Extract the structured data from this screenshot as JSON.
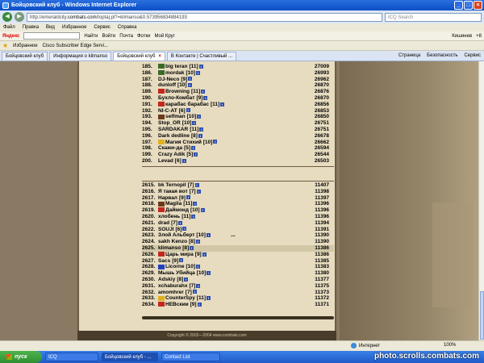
{
  "window": {
    "title": "Бойцовский клуб - Windows Internet Explorer"
  },
  "address": {
    "url_prefix": "http://emeraldcity.",
    "url_domain": "combats.com",
    "url_suffix": "/toptaj.pl?=klimanso&0.573956834884193",
    "search_placeholder": "ICQ Search"
  },
  "menu": [
    "Файл",
    "Правка",
    "Вид",
    "Избранное",
    "Сервис",
    "Справка"
  ],
  "yandex": {
    "logo": "Яндекс",
    "find": "Найти",
    "login": "Войти",
    "mail": "Почта",
    "photos": "Фотки",
    "mycircle": "Мой Круг",
    "city": "Кишинев",
    "temp": "+8"
  },
  "favorites": {
    "label": "Избранное",
    "link": "Cisco Subscriber Edge Servi..."
  },
  "tabs": [
    {
      "label": "Бойцовский клуб",
      "active": false
    },
    {
      "label": "Информация о klimanso",
      "active": false
    },
    {
      "label": "Бойцовский клуб",
      "active": true
    },
    {
      "label": "В Контакте | Счастливый ...",
      "active": false
    }
  ],
  "tab_commands": {
    "page": "Страница",
    "safety": "Безопасность",
    "service": "Сервис"
  },
  "top_rows": [
    {
      "n": "185.",
      "name": "big teran",
      "lvl": "[11]",
      "score": "27009",
      "icon": "g"
    },
    {
      "n": "186.",
      "name": "mordak",
      "lvl": "[10]",
      "score": "26993",
      "icon": "g"
    },
    {
      "n": "187.",
      "name": "DJ-Neco",
      "lvl": "[9]",
      "score": "26962",
      "icon": ""
    },
    {
      "n": "188.",
      "name": "dunloff",
      "lvl": "[10]",
      "score": "26870",
      "icon": ""
    },
    {
      "n": "189.",
      "name": "Browning",
      "lvl": "[11]",
      "score": "26876",
      "icon": "r"
    },
    {
      "n": "190.",
      "name": "Бухло-Комбат",
      "lvl": "[9]",
      "score": "26870",
      "icon": ""
    },
    {
      "n": "191.",
      "name": "карабас барабас",
      "lvl": "[11]",
      "score": "26856",
      "icon": "r"
    },
    {
      "n": "192.",
      "name": "NI-C-AT",
      "lvl": "[6]",
      "score": "26853",
      "icon": ""
    },
    {
      "n": "193.",
      "name": "selfman",
      "lvl": "[10]",
      "score": "26850",
      "icon": "b"
    },
    {
      "n": "194.",
      "name": "Stop_OR",
      "lvl": "[10]",
      "score": "26751",
      "icon": ""
    },
    {
      "n": "195.",
      "name": "SARDAKAR",
      "lvl": "[11]",
      "score": "26751",
      "icon": ""
    },
    {
      "n": "196.",
      "name": "Dark dedline",
      "lvl": "[8]",
      "score": "26678",
      "icon": ""
    },
    {
      "n": "197.",
      "name": "Магия Стихий",
      "lvl": "[10]",
      "score": "26662",
      "icon": "y"
    },
    {
      "n": "198.",
      "name": "Скажи-да",
      "lvl": "[5]",
      "score": "26594",
      "icon": ""
    },
    {
      "n": "199.",
      "name": "Crazy Adik",
      "lvl": "[5]",
      "score": "26544",
      "icon": ""
    },
    {
      "n": "200.",
      "name": "Levad",
      "lvl": "[6]",
      "score": "26503",
      "icon": ""
    }
  ],
  "ellipsis": "...",
  "bottom_rows": [
    {
      "n": "2615.",
      "name": "bk Ternopil",
      "lvl": "[7]",
      "score": "11407",
      "icon": "",
      "hl": false
    },
    {
      "n": "2616.",
      "name": "Я такая вот",
      "lvl": "[7]",
      "score": "11398",
      "icon": "",
      "hl": false
    },
    {
      "n": "2617.",
      "name": "Нарвал",
      "lvl": "[9]",
      "score": "11397",
      "icon": "",
      "hl": false
    },
    {
      "n": "2618.",
      "name": "Magila",
      "lvl": "[11]",
      "score": "11396",
      "icon": "b",
      "hl": false
    },
    {
      "n": "2619.",
      "name": "Даймонд",
      "lvl": "[10]",
      "score": "11396",
      "icon": "r",
      "hl": false
    },
    {
      "n": "2620.",
      "name": "хлобень",
      "lvl": "[11]",
      "score": "11396",
      "icon": "",
      "hl": false
    },
    {
      "n": "2621.",
      "name": "drad",
      "lvl": "[7]",
      "score": "11394",
      "icon": "",
      "hl": false
    },
    {
      "n": "2622.",
      "name": "SOUJI",
      "lvl": "[6]",
      "score": "11391",
      "icon": "",
      "hl": false
    },
    {
      "n": "2623.",
      "name": "Злой Альберт",
      "lvl": "[10]",
      "score": "11390",
      "icon": "",
      "hl": false
    },
    {
      "n": "2624.",
      "name": "sakh Kenzo",
      "lvl": "[8]",
      "score": "11390",
      "icon": "",
      "hl": false
    },
    {
      "n": "2625.",
      "name": "klimanso",
      "lvl": "[8]",
      "score": "11386",
      "icon": "",
      "hl": true
    },
    {
      "n": "2626.",
      "name": "Царь мира",
      "lvl": "[9]",
      "score": "11386",
      "icon": "r",
      "hl": false
    },
    {
      "n": "2627.",
      "name": "Sacs",
      "lvl": "[9]",
      "score": "11385",
      "icon": "",
      "hl": false
    },
    {
      "n": "2628.",
      "name": "Licorne",
      "lvl": "[10]",
      "score": "11383",
      "icon": "u",
      "hl": false
    },
    {
      "n": "2629.",
      "name": "Мышь Убийца",
      "lvl": "[10]",
      "score": "11380",
      "icon": "",
      "hl": false
    },
    {
      "n": "2630.",
      "name": "Adskiy",
      "lvl": "[8]",
      "score": "11377",
      "icon": "",
      "hl": false
    },
    {
      "n": "2631.",
      "name": "xchaburahx",
      "lvl": "[7]",
      "score": "11375",
      "icon": "",
      "hl": false
    },
    {
      "n": "2632.",
      "name": "amomhrer",
      "lvl": "[7]",
      "score": "11373",
      "icon": "",
      "hl": false
    },
    {
      "n": "2633.",
      "name": "CounterSpy",
      "lvl": "[11]",
      "score": "11372",
      "icon": "y",
      "hl": false
    },
    {
      "n": "2634.",
      "name": "НЕВскии",
      "lvl": "[9]",
      "score": "11371",
      "icon": "r",
      "hl": false
    }
  ],
  "copyright": "Copyright © 2002—2004 www.combats.com",
  "status": {
    "zone": "Интернет",
    "zoom": "100%"
  },
  "taskbar": {
    "start": "пуск",
    "tasks": [
      "ICQ",
      "Бойцовский клуб - ...",
      "Contact List"
    ]
  },
  "watermark": "photo.scrolls.combats.com",
  "colors": {
    "parchment": "#e7dcc0",
    "highlight_row": "#d2c8a8",
    "titlebar": "#0a4fc4"
  }
}
